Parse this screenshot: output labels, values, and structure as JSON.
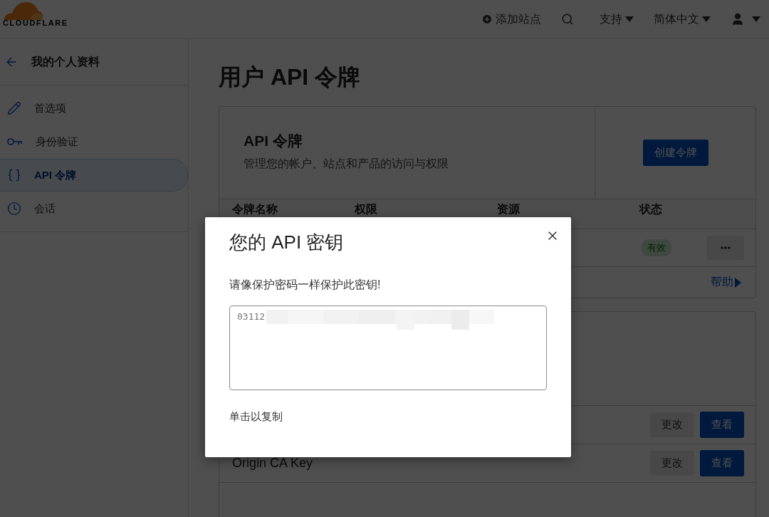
{
  "header": {
    "logo_text": "CLOUDFLARE",
    "add_site": "添加站点",
    "support": "支持",
    "language": "简体中文"
  },
  "sidebar": {
    "back_title": "我的个人资料",
    "items": [
      {
        "label": "首选项",
        "selected": false
      },
      {
        "label": "身份验证",
        "selected": false
      },
      {
        "label": "API 令牌",
        "selected": true
      },
      {
        "label": "会话",
        "selected": false
      }
    ]
  },
  "page_title": "用户 API 令牌",
  "tokens_card": {
    "title": "API 令牌",
    "description": "管理您的帐户、站点和产品的访问与权限",
    "create_button": "创建令牌",
    "columns": [
      "令牌名称",
      "权限",
      "资源",
      "状态"
    ],
    "row": {
      "status": "有效"
    },
    "help_link": "帮助"
  },
  "keys_card": {
    "rows": [
      {
        "edit": "更改",
        "view": "查看"
      },
      {
        "name": "Origin CA Key",
        "edit": "更改",
        "view": "查看"
      }
    ]
  },
  "modal": {
    "title": "您的 API 密钥",
    "warning": "请像保护密码一样保护此密钥!",
    "key_value": "03112",
    "copy_hint": "单击以复制"
  }
}
